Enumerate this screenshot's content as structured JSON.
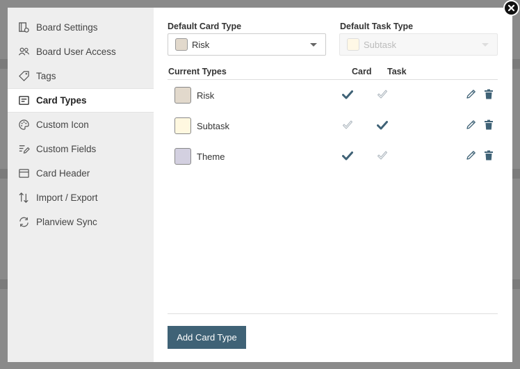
{
  "sidebar": {
    "items": [
      {
        "label": "Board Settings",
        "icon": "board-settings-icon"
      },
      {
        "label": "Board User Access",
        "icon": "users-icon"
      },
      {
        "label": "Tags",
        "icon": "tag-icon"
      },
      {
        "label": "Card Types",
        "icon": "card-types-icon",
        "active": true
      },
      {
        "label": "Custom Icon",
        "icon": "palette-icon"
      },
      {
        "label": "Custom Fields",
        "icon": "custom-fields-icon"
      },
      {
        "label": "Card Header",
        "icon": "card-header-icon"
      },
      {
        "label": "Import / Export",
        "icon": "import-export-icon"
      },
      {
        "label": "Planview Sync",
        "icon": "sync-icon"
      }
    ]
  },
  "defaults": {
    "card_label": "Default Card Type",
    "card_value": "Risk",
    "card_color": "#e2d9cc",
    "task_label": "Default Task Type",
    "task_value": "Subtask",
    "task_color": "#fff8e6",
    "task_disabled": true
  },
  "table": {
    "header": "Current Types",
    "col_card": "Card",
    "col_task": "Task",
    "rows": [
      {
        "name": "Risk",
        "color": "#e2d9cc",
        "card": true,
        "task": false
      },
      {
        "name": "Subtask",
        "color": "#fff8e0",
        "card": false,
        "task": true
      },
      {
        "name": "Theme",
        "color": "#d3d0e0",
        "card": true,
        "task": false
      }
    ]
  },
  "add_button": "Add Card Type",
  "colors": {
    "accent": "#3f6276",
    "check_on": "#3f6276",
    "check_off": "#aab4bc"
  }
}
